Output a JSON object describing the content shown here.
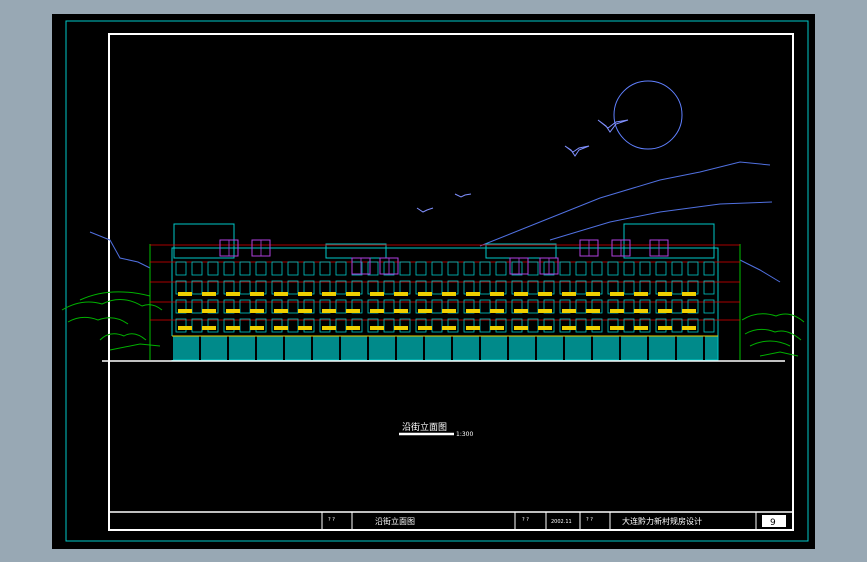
{
  "drawing": {
    "title": "沿街立面图",
    "scale": "1:300",
    "title_block": {
      "cell_a_top": "? ?",
      "drawing_name": "沿街立面图",
      "cell_b_top": "? ?",
      "date": "2002.11",
      "cell_c_top": "? ?",
      "project": "大连黔力新村规房设计",
      "sheet_number": "9"
    }
  },
  "colors": {
    "background": "#000000",
    "frame": "#ffffff",
    "outline": "#00c8c8",
    "accent_yellow": "#f0d000",
    "accent_red": "#e00000",
    "window": "#b040e0",
    "vegetation": "#00c000",
    "sky_line": "#6080ff"
  }
}
